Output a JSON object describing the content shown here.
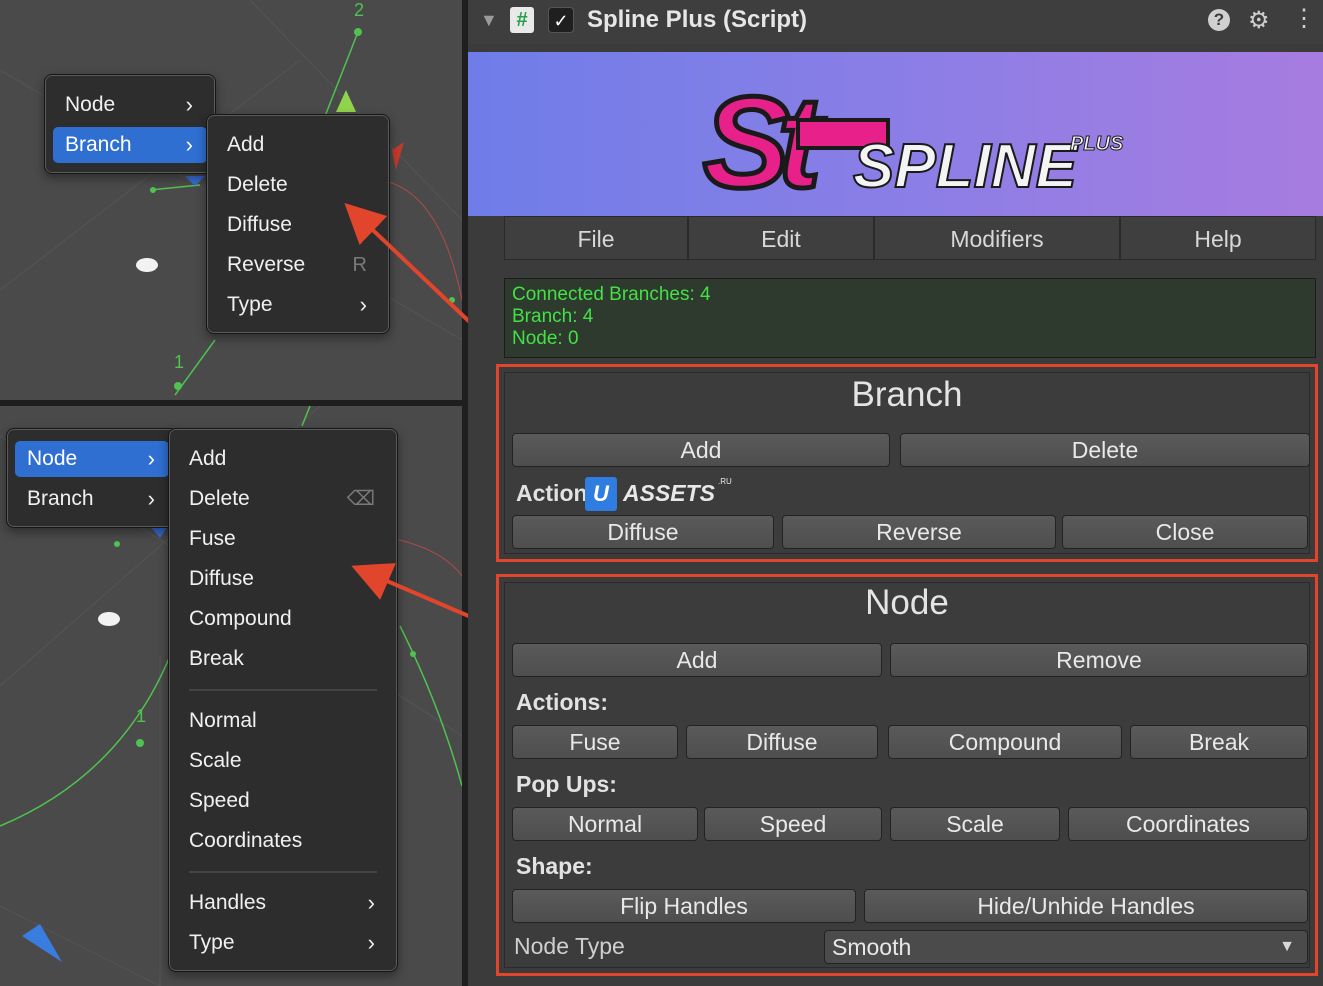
{
  "top_scene": {
    "axis_label_2": "2",
    "axis_label_1": "1",
    "menu": {
      "items": [
        {
          "label": "Node"
        },
        {
          "label": "Branch"
        }
      ],
      "selected": "Branch"
    },
    "submenu": {
      "items": [
        {
          "label": "Add"
        },
        {
          "label": "Delete"
        },
        {
          "label": "Diffuse"
        },
        {
          "label": "Reverse",
          "shortcut": "R"
        },
        {
          "label": "Type"
        }
      ]
    }
  },
  "bottom_scene": {
    "axis_label_1": "1",
    "menu": {
      "items": [
        {
          "label": "Node"
        },
        {
          "label": "Branch"
        }
      ],
      "selected": "Node"
    },
    "submenu": {
      "items": [
        {
          "label": "Add"
        },
        {
          "label": "Delete"
        },
        {
          "label": "Fuse"
        },
        {
          "label": "Diffuse"
        },
        {
          "label": "Compound"
        },
        {
          "label": "Break"
        },
        {
          "label": "Normal"
        },
        {
          "label": "Scale"
        },
        {
          "label": "Speed"
        },
        {
          "label": "Coordinates"
        },
        {
          "label": "Handles"
        },
        {
          "label": "Type"
        }
      ]
    }
  },
  "inspector": {
    "title": "Spline Plus (Script)",
    "enabled": true,
    "banner": {
      "logo_text": "SPLINE",
      "logo_sub": "PLUS"
    },
    "menu_tabs": [
      "File",
      "Edit",
      "Modifiers",
      "Help"
    ],
    "info": [
      "Connected Branches: 4",
      "Branch: 4",
      "Node: 0"
    ],
    "branch": {
      "title": "Branch",
      "add": "Add",
      "delete": "Delete",
      "actions_label": "Actions:",
      "diffuse": "Diffuse",
      "reverse": "Reverse",
      "close": "Close"
    },
    "watermark": {
      "badge": "U",
      "text": "ASSETS",
      "sup": ".RU"
    },
    "node": {
      "title": "Node",
      "add": "Add",
      "remove": "Remove",
      "actions_label": "Actions:",
      "fuse": "Fuse",
      "diffuse": "Diffuse",
      "compound": "Compound",
      "break": "Break",
      "popups_label": "Pop Ups:",
      "normal": "Normal",
      "speed": "Speed",
      "scale": "Scale",
      "coordinates": "Coordinates",
      "shape_label": "Shape:",
      "flip_handles": "Flip Handles",
      "hide_handles": "Hide/Unhide Handles",
      "node_type_label": "Node Type",
      "node_type_value": "Smooth"
    }
  },
  "colors": {
    "accent_blue": "#2f6fd1",
    "highlight_red": "#e1452c",
    "info_green": "#43e046",
    "logo_pink": "#e8208a"
  }
}
